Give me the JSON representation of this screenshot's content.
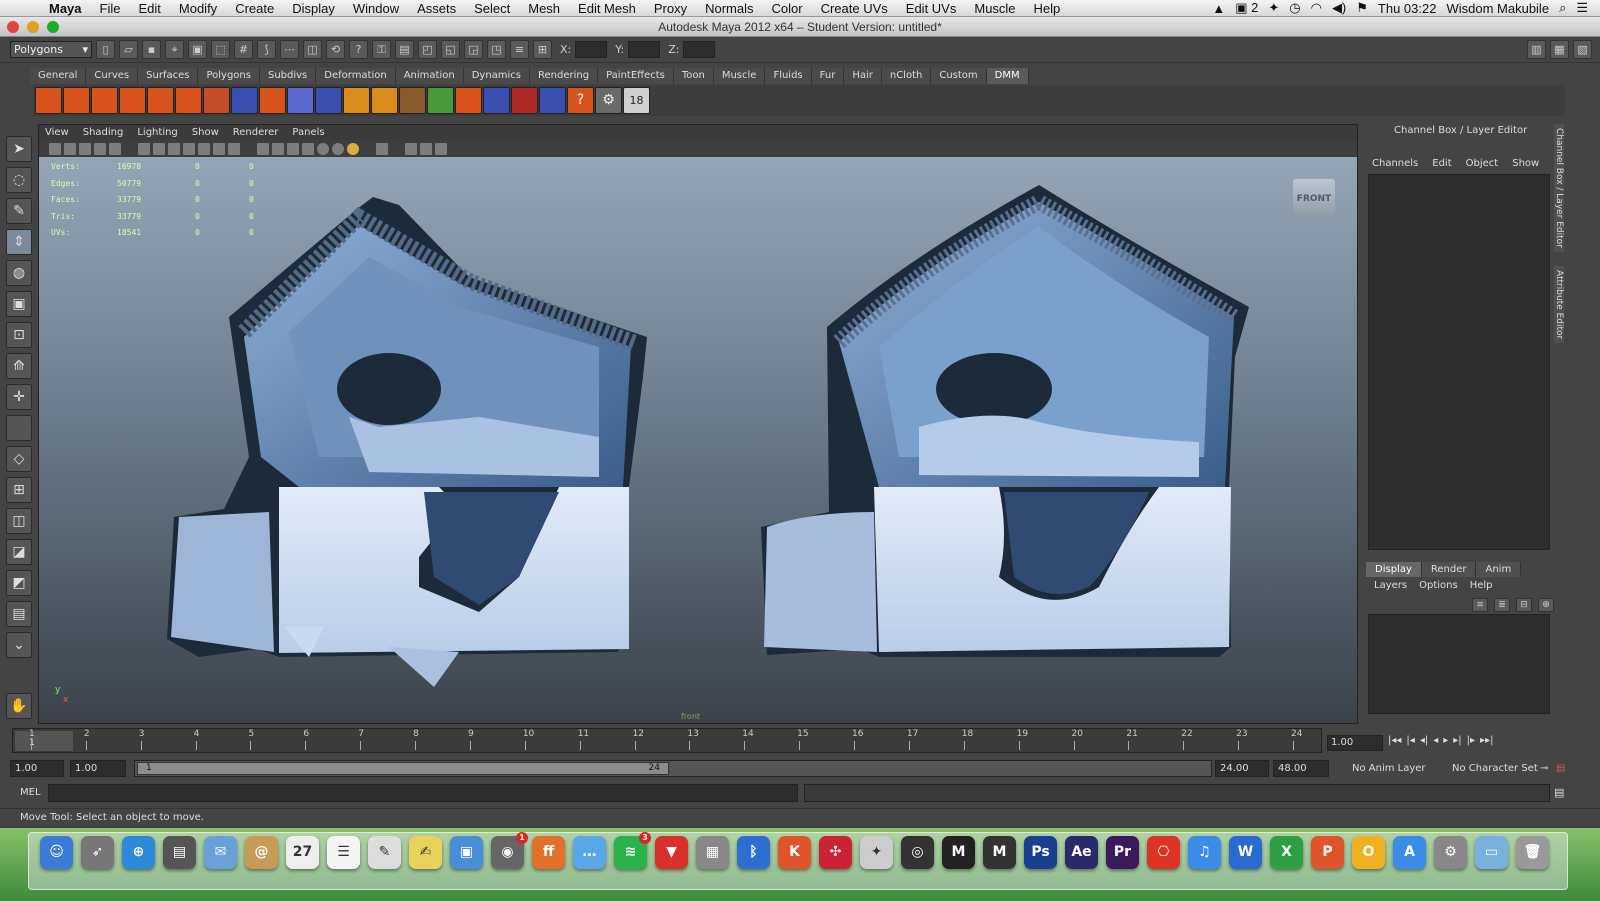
{
  "menubar": {
    "app": "Maya",
    "items": [
      "File",
      "Edit",
      "Modify",
      "Create",
      "Display",
      "Window",
      "Assets",
      "Select",
      "Mesh",
      "Edit Mesh",
      "Proxy",
      "Normals",
      "Color",
      "Create UVs",
      "Edit UVs",
      "Muscle",
      "Help"
    ],
    "status_num": "2",
    "clock": "Thu 03:22",
    "user": "Wisdom Makubile"
  },
  "window": {
    "title": "Autodesk Maya 2012 x64 – Student Version: untitled*"
  },
  "status_line": {
    "menu_set": "Polygons",
    "x_label": "X:",
    "y_label": "Y:",
    "z_label": "Z:"
  },
  "shelf": {
    "tabs": [
      "General",
      "Curves",
      "Surfaces",
      "Polygons",
      "Subdivs",
      "Deformation",
      "Animation",
      "Dynamics",
      "Rendering",
      "PaintEffects",
      "Toon",
      "Muscle",
      "Fluids",
      "Fur",
      "Hair",
      "nCloth",
      "Custom",
      "DMM"
    ],
    "active_tab": "DMM",
    "help_glyph": "?",
    "last_label": "18"
  },
  "panel": {
    "menu": [
      "View",
      "Shading",
      "Lighting",
      "Show",
      "Renderer",
      "Panels"
    ],
    "hud": [
      {
        "label": "Verts:",
        "value": "16978",
        "a": "0",
        "b": "0"
      },
      {
        "label": "Edges:",
        "value": "50779",
        "a": "0",
        "b": "0"
      },
      {
        "label": "Faces:",
        "value": "33779",
        "a": "0",
        "b": "0"
      },
      {
        "label": "Tris:",
        "value": "33779",
        "a": "0",
        "b": "0"
      },
      {
        "label": "UVs:",
        "value": "18541",
        "a": "0",
        "b": "0"
      }
    ],
    "view_cube": "FRONT",
    "camera": "front",
    "axis_y": "y",
    "axis_x": "x"
  },
  "channel_box": {
    "title": "Channel Box / Layer Editor",
    "menu": [
      "Channels",
      "Edit",
      "Object",
      "Show"
    ],
    "layer_tabs": [
      "Display",
      "Render",
      "Anim"
    ],
    "active_layer_tab": "Display",
    "layer_menu": [
      "Layers",
      "Options",
      "Help"
    ],
    "side_tabs": [
      "Channel Box / Layer Editor",
      "Attribute Editor"
    ]
  },
  "timeline": {
    "numbers": [
      "1",
      "2",
      "3",
      "4",
      "5",
      "6",
      "7",
      "8",
      "9",
      "10",
      "11",
      "12",
      "13",
      "14",
      "15",
      "16",
      "17",
      "18",
      "19",
      "20",
      "21",
      "22",
      "23",
      "24"
    ],
    "current_marker": "1",
    "current_frame": "1.00",
    "buttons": [
      "|◂◂",
      "|◂",
      "◂|",
      "◂",
      "▸",
      "▸|",
      "|▸",
      "▸▸|"
    ]
  },
  "range": {
    "start": "1.00",
    "playback_start": "1.00",
    "slider_start": "1",
    "slider_end": "24",
    "playback_end": "24.00",
    "end": "48.00",
    "anim_layer": "No Anim Layer",
    "character_set": "No Character Set"
  },
  "command_line": {
    "label": "MEL"
  },
  "help_line": {
    "text": "Move Tool: Select an object to move."
  },
  "dock": {
    "icons": [
      {
        "name": "finder",
        "label": "☺",
        "color": "#3a7bd5"
      },
      {
        "name": "launchpad",
        "label": "➶",
        "color": "#777"
      },
      {
        "name": "safari",
        "label": "⊕",
        "color": "#2d8ad8"
      },
      {
        "name": "photo-browser",
        "label": "▤",
        "color": "#555"
      },
      {
        "name": "mail",
        "label": "✉",
        "color": "#6aa0d8"
      },
      {
        "name": "contacts",
        "label": "@",
        "color": "#c79a55"
      },
      {
        "name": "calendar",
        "label": "27",
        "color": "#eee"
      },
      {
        "name": "reminders",
        "label": "☰",
        "color": "#f5f5f5"
      },
      {
        "name": "textedit",
        "label": "✎",
        "color": "#ddd"
      },
      {
        "name": "notes",
        "label": "✍",
        "color": "#e8d35a"
      },
      {
        "name": "preview",
        "label": "▣",
        "color": "#4a8ed8"
      },
      {
        "name": "itunes-camera",
        "label": "◉",
        "color": "#666",
        "badge": "1"
      },
      {
        "name": "firefox",
        "label": "ff",
        "color": "#e0702a"
      },
      {
        "name": "messages",
        "label": "…",
        "color": "#59a6e8"
      },
      {
        "name": "spotify",
        "label": "≋",
        "color": "#2bb24c",
        "badge": "3"
      },
      {
        "name": "downloader",
        "label": "▼",
        "color": "#d9302a"
      },
      {
        "name": "image-capture",
        "label": "▦",
        "color": "#888"
      },
      {
        "name": "bluetooth",
        "label": "ᛒ",
        "color": "#2c6fd1"
      },
      {
        "name": "kuler",
        "label": "K",
        "color": "#e0542a"
      },
      {
        "name": "joystick",
        "label": "✣",
        "color": "#c23"
      },
      {
        "name": "installer",
        "label": "✦",
        "color": "#ccc"
      },
      {
        "name": "aperture",
        "label": "◎",
        "color": "#333"
      },
      {
        "name": "maya-a",
        "label": "M",
        "color": "#222"
      },
      {
        "name": "maya-b",
        "label": "M",
        "color": "#333"
      },
      {
        "name": "photoshop",
        "label": "Ps",
        "color": "#1a3f8f"
      },
      {
        "name": "after-effects",
        "label": "Ae",
        "color": "#2a2a6a"
      },
      {
        "name": "premiere",
        "label": "Pr",
        "color": "#3a1a5a"
      },
      {
        "name": "acrobat",
        "label": "⎔",
        "color": "#d32"
      },
      {
        "name": "itunes",
        "label": "♫",
        "color": "#3a8ce8"
      },
      {
        "name": "word",
        "label": "W",
        "color": "#2a6bd1"
      },
      {
        "name": "excel",
        "label": "X",
        "color": "#2ea043"
      },
      {
        "name": "powerpoint",
        "label": "P",
        "color": "#e0542a"
      },
      {
        "name": "outlook",
        "label": "O",
        "color": "#f0b020"
      },
      {
        "name": "app-store",
        "label": "A",
        "color": "#3a8ce8"
      },
      {
        "name": "system-preferences",
        "label": "⚙",
        "color": "#888"
      },
      {
        "name": "downloads-folder",
        "label": "▭",
        "color": "#7ab0e0"
      },
      {
        "name": "trash",
        "label": "🗑",
        "color": "#999"
      }
    ]
  }
}
